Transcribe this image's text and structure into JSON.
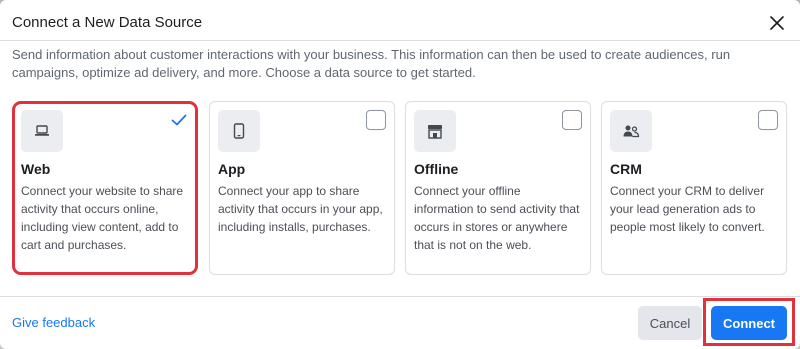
{
  "dialog": {
    "title": "Connect a New Data Source",
    "intro": "Send information about customer interactions with your business. This information can then be used to create audiences, run campaigns, optimize ad delivery, and more. Choose a data source to get started."
  },
  "sources": [
    {
      "icon": "laptop-icon",
      "title": "Web",
      "description": "Connect your website to share activity that occurs online, including view content, add to cart and purchases.",
      "selected": true
    },
    {
      "icon": "phone-icon",
      "title": "App",
      "description": "Connect your app to share activity that occurs in your app, including installs, purchases.",
      "selected": false
    },
    {
      "icon": "store-icon",
      "title": "Offline",
      "description": "Connect your offline information to send activity that occurs in stores or anywhere that is not on the web.",
      "selected": false
    },
    {
      "icon": "people-icon",
      "title": "CRM",
      "description": "Connect your CRM to deliver your lead generation ads to people most likely to convert.",
      "selected": false
    }
  ],
  "footer": {
    "feedback_label": "Give feedback",
    "cancel_label": "Cancel",
    "connect_label": "Connect"
  },
  "colors": {
    "accent": "#1877f2",
    "highlight": "#e0313d",
    "text_primary": "#1c1e21",
    "text_secondary": "#606770"
  }
}
